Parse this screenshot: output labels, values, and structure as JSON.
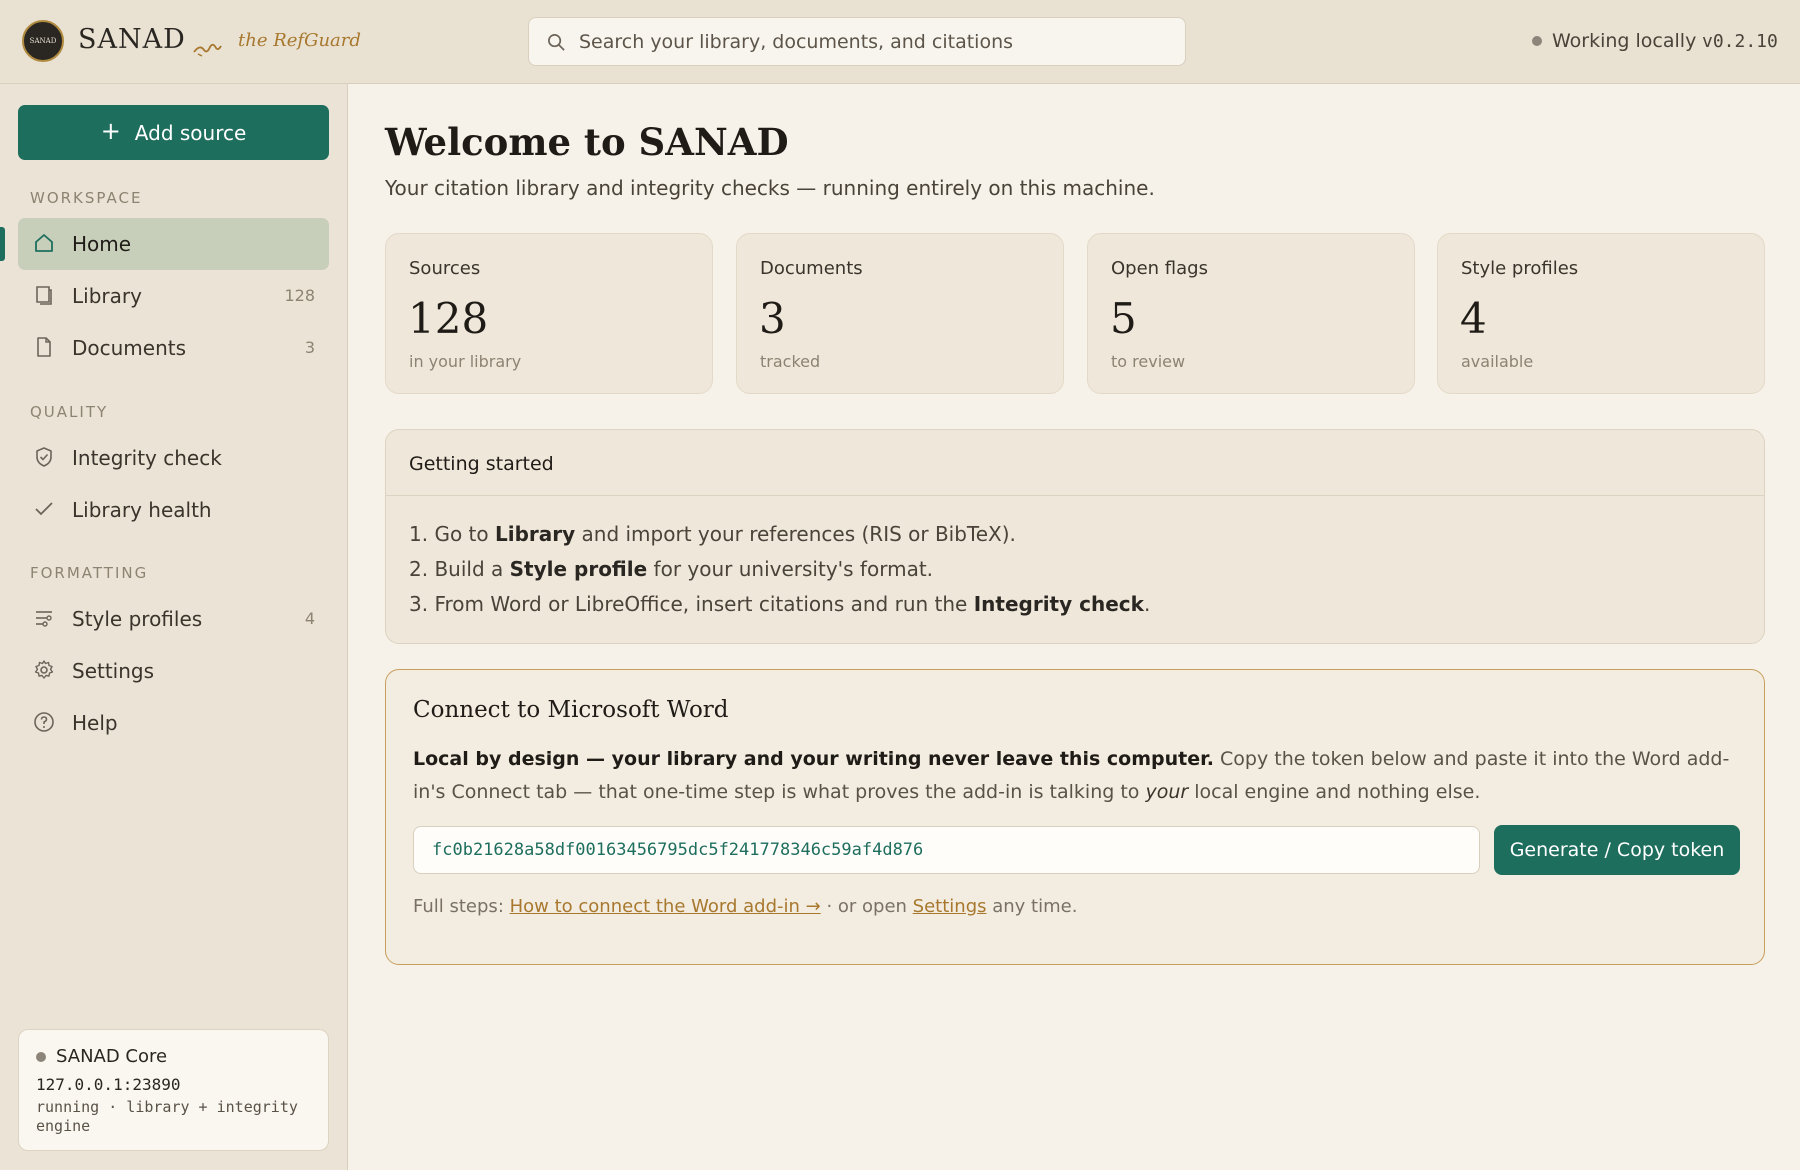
{
  "header": {
    "logo_text": "SANAD",
    "brand": "SANAD",
    "tagline": "the RefGuard",
    "search_placeholder": "Search your library, documents, and citations",
    "status": "Working locally",
    "version": "v0.2.10"
  },
  "sidebar": {
    "add_button": "Add source",
    "sections": {
      "workspace": "WORKSPACE",
      "quality": "QUALITY",
      "formatting": "FORMATTING"
    },
    "items": [
      {
        "label": "Home",
        "count": "",
        "icon": "home-icon"
      },
      {
        "label": "Library",
        "count": "128",
        "icon": "book-icon"
      },
      {
        "label": "Documents",
        "count": "3",
        "icon": "document-icon"
      },
      {
        "label": "Integrity check",
        "count": "",
        "icon": "shield-check-icon"
      },
      {
        "label": "Library health",
        "count": "",
        "icon": "check-icon"
      },
      {
        "label": "Style profiles",
        "count": "4",
        "icon": "sliders-icon"
      },
      {
        "label": "Settings",
        "count": "",
        "icon": "gear-icon"
      },
      {
        "label": "Help",
        "count": "",
        "icon": "help-circle-icon"
      }
    ],
    "core": {
      "title": "SANAD Core",
      "host": "127.0.0.1:23890",
      "desc": "running · library + integrity engine"
    }
  },
  "main": {
    "title": "Welcome to SANAD",
    "subtitle": "Your citation library and integrity checks — running entirely on this machine.",
    "stats": [
      {
        "label": "Sources",
        "value": "128",
        "sub": "in your library"
      },
      {
        "label": "Documents",
        "value": "3",
        "sub": "tracked"
      },
      {
        "label": "Open flags",
        "value": "5",
        "sub": "to review"
      },
      {
        "label": "Style profiles",
        "value": "4",
        "sub": "available"
      }
    ],
    "getting_started": {
      "title": "Getting started",
      "steps": [
        {
          "pre": "1. Go to ",
          "bold": "Library",
          "post": " and import your references (RIS or BibTeX)."
        },
        {
          "pre": "2. Build a ",
          "bold": "Style profile",
          "post": " for your university's format."
        },
        {
          "pre": "3. From Word or LibreOffice, insert citations and run the ",
          "bold": "Integrity check",
          "post": "."
        }
      ]
    },
    "word_connect": {
      "title": "Connect to Microsoft Word",
      "desc_bold": "Local by design — your library and your writing never leave this computer.",
      "desc_text": " Copy the token below and paste it into the Word add-in's Connect tab — that one-time step is what proves the add-in is talking to ",
      "desc_italic": "your",
      "desc_end": " local engine and nothing else.",
      "token": "fc0b21628a58df00163456795dc5f241778346c59af4d876",
      "button": "Generate / Copy token",
      "foot_pre": "Full steps: ",
      "foot_link": "How to connect the Word add-in →",
      "foot_mid": " · or open ",
      "foot_link2": "Settings",
      "foot_post": " any time."
    }
  },
  "colors": {
    "accent": "#1e6e5e",
    "gold": "#a8782e",
    "sidebar_bg": "#ebe3d5",
    "page_bg": "#f6f2e9"
  }
}
